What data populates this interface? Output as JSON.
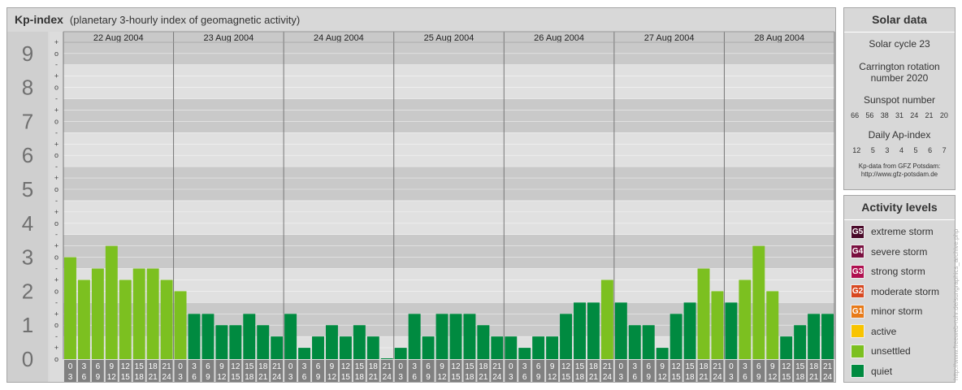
{
  "header": {
    "title": "Kp-index",
    "subtitle": "(planetary 3-hourly index of geomagnetic activity)"
  },
  "solar": {
    "title": "Solar data",
    "cycle": "Solar cycle 23",
    "carrington_1": "Carrington rotation",
    "carrington_2": "number 2020",
    "sunspot_title": "Sunspot number",
    "sunspot_numbers": [
      "66",
      "56",
      "38",
      "31",
      "24",
      "21",
      "20"
    ],
    "ap_title": "Daily Ap-index",
    "ap_numbers": [
      "12",
      "5",
      "3",
      "4",
      "5",
      "6",
      "7"
    ],
    "credit_1": "Kp-data from GFZ Potsdam:",
    "credit_2": "http://www.gfz-potsdam.de"
  },
  "levels": {
    "title": "Activity levels",
    "items": [
      {
        "code": "G5",
        "label": "extreme storm",
        "color": "#4a0a2a"
      },
      {
        "code": "G4",
        "label": "severe storm",
        "color": "#7a1040"
      },
      {
        "code": "G3",
        "label": "strong storm",
        "color": "#b01050"
      },
      {
        "code": "G2",
        "label": "moderate storm",
        "color": "#d84820"
      },
      {
        "code": "G1",
        "label": "minor storm",
        "color": "#e87a18"
      },
      {
        "code": "",
        "label": "active",
        "color": "#f8c400"
      },
      {
        "code": "",
        "label": "unsettled",
        "color": "#7cc020"
      },
      {
        "code": "",
        "label": "quiet",
        "color": "#008a40"
      }
    ]
  },
  "watermark": "http://www.freeweb-ruhr.de/sungraphics_archive.php",
  "chart_data": {
    "type": "bar",
    "ylim": [
      0,
      9
    ],
    "y_ticks": [
      "0",
      "1",
      "2",
      "3",
      "4",
      "5",
      "6",
      "7",
      "8",
      "9"
    ],
    "minor_ticks": [
      "-",
      "o",
      "+"
    ],
    "days": [
      "22 Aug 2004",
      "23 Aug 2004",
      "24 Aug 2004",
      "25 Aug 2004",
      "26 Aug 2004",
      "27 Aug 2004",
      "28 Aug 2004"
    ],
    "intervals": [
      [
        "0",
        "3"
      ],
      [
        "3",
        "6"
      ],
      [
        "6",
        "9"
      ],
      [
        "9",
        "12"
      ],
      [
        "12",
        "15"
      ],
      [
        "15",
        "18"
      ],
      [
        "18",
        "21"
      ],
      [
        "21",
        "24"
      ]
    ],
    "values": [
      3.0,
      2.333,
      2.667,
      3.333,
      2.333,
      2.667,
      2.667,
      2.333,
      2.0,
      1.333,
      1.333,
      1.0,
      1.0,
      1.333,
      1.0,
      0.667,
      1.333,
      0.333,
      0.667,
      1.0,
      0.667,
      1.0,
      0.667,
      0.0,
      0.333,
      1.333,
      0.667,
      1.333,
      1.333,
      1.333,
      1.0,
      0.667,
      0.667,
      0.333,
      0.667,
      0.667,
      1.333,
      1.667,
      1.667,
      2.333,
      1.667,
      1.0,
      1.0,
      0.333,
      1.333,
      1.667,
      2.667,
      2.0,
      1.667,
      2.333,
      3.333,
      2.0,
      0.667,
      1.0,
      1.333,
      1.333
    ],
    "colors": {
      "quiet": "#008a40",
      "unsettled": "#7cc020"
    }
  }
}
